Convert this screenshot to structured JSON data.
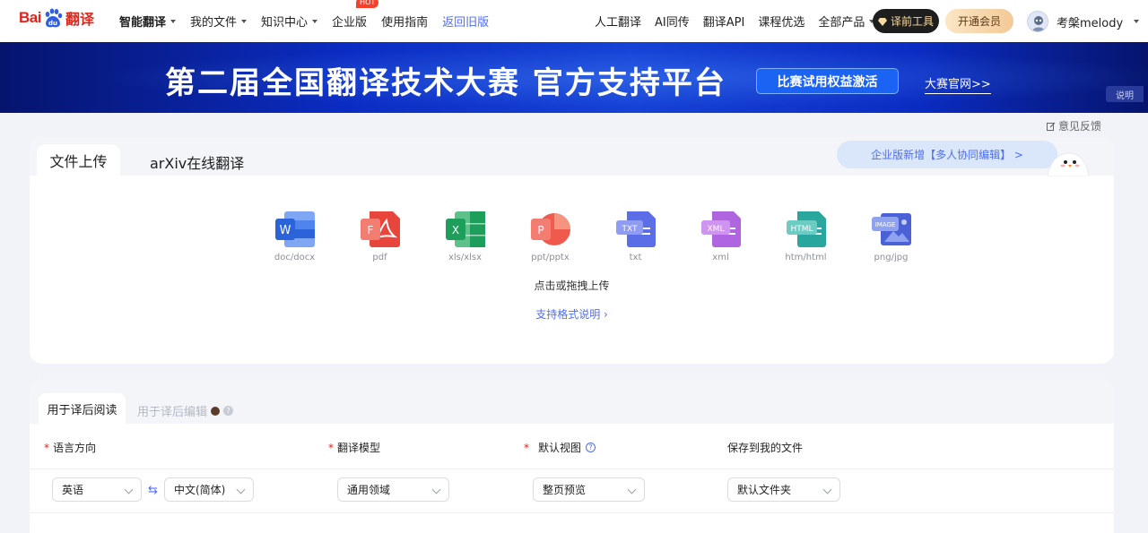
{
  "logo": {
    "text_left": "Bai",
    "text_paw": "du",
    "text_right": "翻译"
  },
  "nav": {
    "left": [
      {
        "label": "智能翻译",
        "dropdown": true,
        "bold": true
      },
      {
        "label": "我的文件",
        "dropdown": true
      },
      {
        "label": "知识中心",
        "dropdown": true
      },
      {
        "label": "企业版",
        "badge": "HOT"
      },
      {
        "label": "使用指南"
      },
      {
        "label": "返回旧版"
      }
    ],
    "right": [
      {
        "label": "人工翻译"
      },
      {
        "label": "AI同传"
      },
      {
        "label": "翻译API"
      },
      {
        "label": "课程优选"
      },
      {
        "label": "全部产品",
        "dropdown": true
      }
    ],
    "tools_button": "译前工具",
    "vip_button": "开通会员",
    "username": "考槃melody"
  },
  "banner": {
    "title": "第二届全国翻译技术大赛  官方支持平台",
    "button": "比赛试用权益激活",
    "link": "大赛官网>>",
    "note": "说明"
  },
  "feedback": "意见反馈",
  "upload": {
    "tabs": [
      "文件上传",
      "arXiv在线翻译"
    ],
    "enterprise_pill": "企业版新增【多人协同编辑】 >",
    "file_types": [
      {
        "icon": "word-icon",
        "label": "doc/docx",
        "mark": "W",
        "color": "#2b63d9"
      },
      {
        "icon": "pdf-icon",
        "label": "pdf",
        "mark": "F",
        "color": "#e8453c"
      },
      {
        "icon": "excel-icon",
        "label": "xls/xlsx",
        "mark": "X",
        "color": "#1d9e5b"
      },
      {
        "icon": "ppt-icon",
        "label": "ppt/pptx",
        "mark": "P",
        "color": "#ef5a4c"
      },
      {
        "icon": "txt-icon",
        "label": "txt",
        "mark": "TXT",
        "color": "#5b6ee8"
      },
      {
        "icon": "xml-icon",
        "label": "xml",
        "mark": "XML",
        "color": "#b065e0"
      },
      {
        "icon": "html-icon",
        "label": "htm/html",
        "mark": "HTML",
        "color": "#29a79e"
      },
      {
        "icon": "image-icon",
        "label": "png/jpg",
        "mark": "IMAGE",
        "color": "#4a62d6"
      }
    ],
    "hint": "点击或拖拽上传",
    "format_link": "支持格式说明 ›"
  },
  "settings": {
    "tabs": [
      "用于译后阅读",
      "用于译后编辑"
    ],
    "help_glyph": "?",
    "fields": {
      "language": {
        "label": "语言方向",
        "required": true,
        "source": "英语",
        "target": "中文(简体)",
        "swap": "⇆"
      },
      "model": {
        "label": "翻译模型",
        "required": true,
        "value": "通用领域"
      },
      "view": {
        "label": "默认视图",
        "required": true,
        "value": "整页预览"
      },
      "save": {
        "label": "保存到我的文件",
        "required": false,
        "value": "默认文件夹"
      }
    }
  }
}
